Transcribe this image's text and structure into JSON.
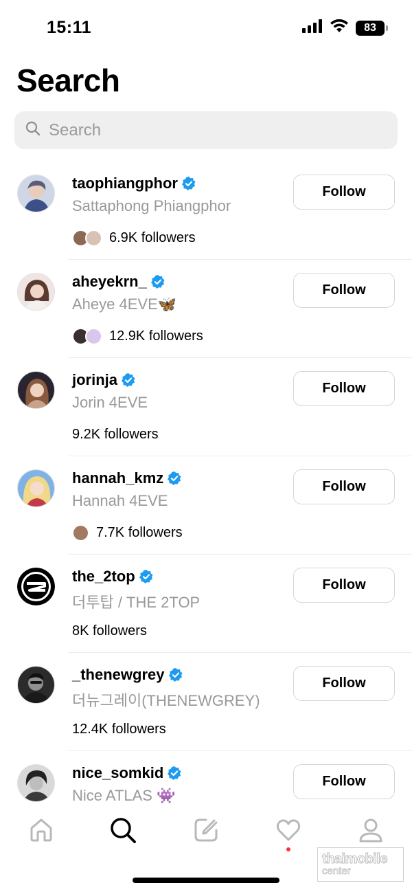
{
  "status_bar": {
    "time": "15:11",
    "battery": "83"
  },
  "page": {
    "title": "Search"
  },
  "search": {
    "placeholder": "Search"
  },
  "results": [
    {
      "username": "taophiangphor",
      "display_name": "Sattaphong Phiangphor",
      "followers": "6.9K followers",
      "follow_label": "Follow",
      "mutual_avatars": 2,
      "avatar_color": "#8a97b3"
    },
    {
      "username": "aheyekrn_",
      "display_name": "Aheye 4EVE🦋",
      "followers": "12.9K followers",
      "follow_label": "Follow",
      "mutual_avatars": 2,
      "avatar_color": "#c9a79a"
    },
    {
      "username": "jorinja",
      "display_name": "Jorin 4EVE",
      "followers": "9.2K followers",
      "follow_label": "Follow",
      "mutual_avatars": 0,
      "avatar_color": "#6b4a3a"
    },
    {
      "username": "hannah_kmz",
      "display_name": "Hannah 4EVE",
      "followers": "7.7K followers",
      "follow_label": "Follow",
      "mutual_avatars": 1,
      "avatar_color": "#e8c98a"
    },
    {
      "username": "the_2top",
      "display_name": "더투탑 / THE 2TOP",
      "followers": "8K followers",
      "follow_label": "Follow",
      "mutual_avatars": 0,
      "avatar_color": "#000000"
    },
    {
      "username": "_thenewgrey",
      "display_name": "더뉴그레이(THENEWGREY)",
      "followers": "12.4K followers",
      "follow_label": "Follow",
      "mutual_avatars": 0,
      "avatar_color": "#3a3a3a"
    },
    {
      "username": "nice_somkid",
      "display_name": "Nice ATLAS 👾",
      "followers": "",
      "follow_label": "Follow",
      "mutual_avatars": 0,
      "avatar_color": "#6e6e6e"
    }
  ],
  "bottom_nav": {
    "items": [
      "home-icon",
      "search-icon",
      "compose-icon",
      "heart-icon",
      "profile-icon"
    ],
    "active": "search-icon"
  },
  "watermark": {
    "line1": "thaimobile",
    "line2": "center"
  },
  "colors": {
    "verified": "#1d9bf0",
    "notification_dot": "#ff3040",
    "secondary_text": "#999999"
  }
}
